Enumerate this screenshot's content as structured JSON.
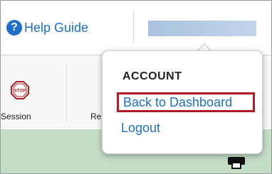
{
  "header": {
    "help_label": "Help Guide",
    "help_icon": "help-circle-icon"
  },
  "toolbar": {
    "stop_session_label": "p Session",
    "stop_icon_text": "STOP",
    "partial_label": "Re"
  },
  "account_menu": {
    "heading": "ACCOUNT",
    "items": [
      {
        "label": "Back to Dashboard",
        "highlighted": true
      },
      {
        "label": "Logout",
        "highlighted": false
      }
    ]
  },
  "colors": {
    "link": "#1d6fc7",
    "highlight_border": "#b01c24",
    "workspace": "#c4ddc6",
    "stop_red": "#b01c24"
  }
}
